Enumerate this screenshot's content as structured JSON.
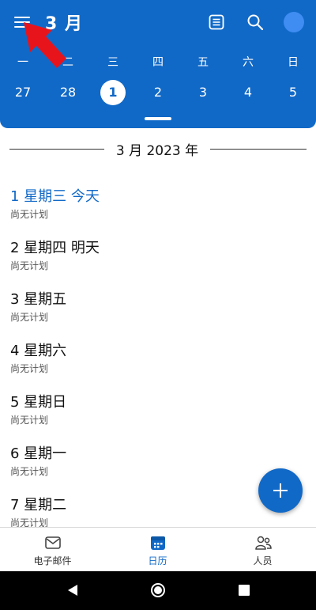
{
  "header": {
    "month_title": "3 月",
    "weekdays": [
      "一",
      "二",
      "三",
      "四",
      "五",
      "六",
      "日"
    ],
    "dates": [
      "27",
      "28",
      "1",
      "2",
      "3",
      "4",
      "5"
    ],
    "selected_date": "1",
    "icons": {
      "menu": "hamburger-menu-icon",
      "agenda": "agenda-view-icon",
      "search": "search-icon",
      "avatar": "avatar"
    }
  },
  "month_divider": "3 月 2023 年",
  "days": [
    {
      "title": "1 星期三  今天",
      "sub": "尚无计划",
      "today": true
    },
    {
      "title": "2 星期四  明天",
      "sub": "尚无计划"
    },
    {
      "title": "3 星期五",
      "sub": "尚无计划"
    },
    {
      "title": "4 星期六",
      "sub": "尚无计划"
    },
    {
      "title": "5 星期日",
      "sub": "尚无计划"
    },
    {
      "title": "6 星期一",
      "sub": "尚无计划"
    },
    {
      "title": "7 星期二",
      "sub": "尚无计划"
    }
  ],
  "bottom_nav": {
    "mail": "电子邮件",
    "calendar": "日历",
    "people": "人员",
    "active": "calendar"
  },
  "colors": {
    "brand": "#1169c7",
    "annotation_arrow": "#e8141c"
  }
}
